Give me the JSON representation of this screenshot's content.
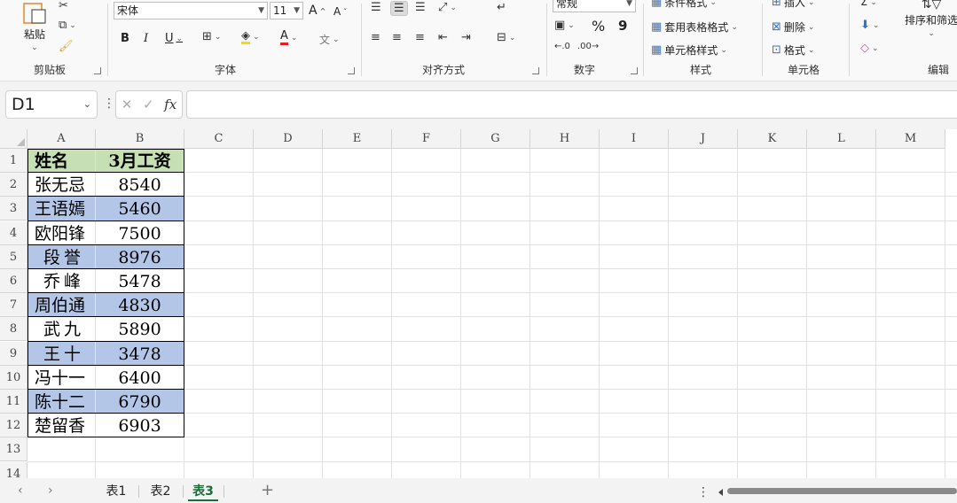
{
  "ribbon": {
    "clipboard": {
      "paste": "粘贴",
      "label": "剪贴板"
    },
    "font": {
      "name": "宋体",
      "size": "11",
      "grow": "A",
      "shrink": "A",
      "bold": "B",
      "italic": "I",
      "underline": "U",
      "font_color_letter": "A",
      "phonetic": "文",
      "label": "字体"
    },
    "alignment": {
      "label": "对齐方式"
    },
    "number": {
      "format": "常规",
      "percent": "%",
      "comma": "9",
      "label": "数字"
    },
    "styles": {
      "conditional": "条件格式",
      "table_format": "套用表格格式",
      "cell_styles": "单元格样式",
      "label": "样式"
    },
    "cells": {
      "insert": "插入",
      "delete": "删除",
      "format": "格式",
      "label": "单元格"
    },
    "editing": {
      "sort_filter": "排序和筛选",
      "label": "编辑"
    }
  },
  "formula_bar": {
    "name_box": "D1",
    "cancel": "✕",
    "enter": "✓",
    "fx": "fx",
    "formula": ""
  },
  "columns": [
    "A",
    "B",
    "C",
    "D",
    "E",
    "F",
    "G",
    "H",
    "I",
    "J",
    "K",
    "L",
    "M"
  ],
  "rows": [
    "1",
    "2",
    "3",
    "4",
    "5",
    "6",
    "7",
    "8",
    "9",
    "10",
    "11",
    "12",
    "13",
    "14"
  ],
  "table": {
    "headers": [
      "姓名",
      "3月工资"
    ],
    "rows": [
      [
        "张无忌",
        "8540"
      ],
      [
        "王语嫣",
        "5460"
      ],
      [
        "欧阳锋",
        "7500"
      ],
      [
        "段誉",
        "8976"
      ],
      [
        "乔峰",
        "5478"
      ],
      [
        "周伯通",
        "4830"
      ],
      [
        "武九",
        "5890"
      ],
      [
        "王十",
        "3478"
      ],
      [
        "冯十一",
        "6400"
      ],
      [
        "陈十二",
        "6790"
      ],
      [
        "楚留香",
        "6903"
      ]
    ]
  },
  "sheets": [
    "表1",
    "表2",
    "表3"
  ],
  "active_sheet": "表3",
  "colors": {
    "header_fill": "#c6e0b4",
    "band_fill": "#b4c6e7",
    "active_tab": "#1e6b3c"
  }
}
